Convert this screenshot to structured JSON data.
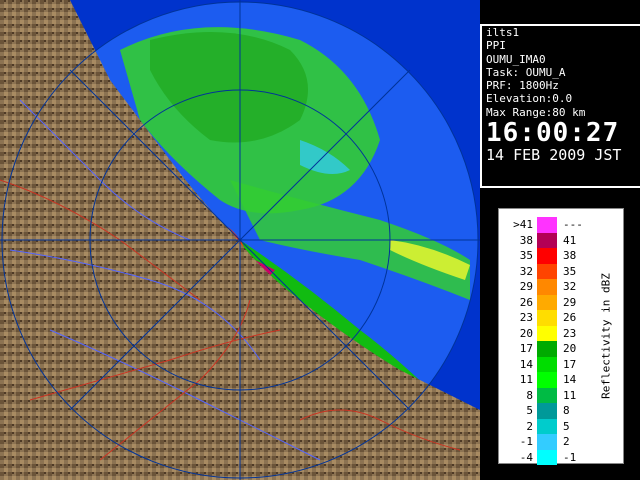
{
  "window": {
    "title": ""
  },
  "info": {
    "station": "ilts1",
    "product": "PPI",
    "site": "OUMU_IMA0",
    "task": "Task: OUMU_A",
    "prf": "PRF: 1800Hz",
    "elevation": "Elevation:0.0",
    "max_range": "Max Range:80 km",
    "time": "16:00:27",
    "date": "14 FEB 2009 JST"
  },
  "legend": {
    "title": "Reflectivity in dBZ",
    "rows": [
      {
        "lo": ">41",
        "hi": "---",
        "color": "#ff33ff"
      },
      {
        "lo": "38",
        "hi": "41",
        "color": "#b30055"
      },
      {
        "lo": "35",
        "hi": "38",
        "color": "#ff0000"
      },
      {
        "lo": "32",
        "hi": "35",
        "color": "#ff4400"
      },
      {
        "lo": "29",
        "hi": "32",
        "color": "#ff8800"
      },
      {
        "lo": "26",
        "hi": "29",
        "color": "#ffaa00"
      },
      {
        "lo": "23",
        "hi": "26",
        "color": "#ffdd00"
      },
      {
        "lo": "20",
        "hi": "23",
        "color": "#ffff00"
      },
      {
        "lo": "17",
        "hi": "20",
        "color": "#00aa00"
      },
      {
        "lo": "14",
        "hi": "17",
        "color": "#00dd00"
      },
      {
        "lo": "11",
        "hi": "14",
        "color": "#00ff00"
      },
      {
        "lo": "8",
        "hi": "11",
        "color": "#00bb44"
      },
      {
        "lo": "5",
        "hi": "8",
        "color": "#009999"
      },
      {
        "lo": "2",
        "hi": "5",
        "color": "#00cccc"
      },
      {
        "lo": "-1",
        "hi": "2",
        "color": "#33ccff"
      },
      {
        "lo": "-4",
        "hi": "-1",
        "color": "#00ffff"
      }
    ]
  },
  "colors": {
    "radar_disk": "#1c5cf0",
    "outside_disk": "#0033cc",
    "land": "#8c7352",
    "land_dark": "#4e3a26",
    "rivers": "#5566ff",
    "borders": "#cc3322"
  }
}
